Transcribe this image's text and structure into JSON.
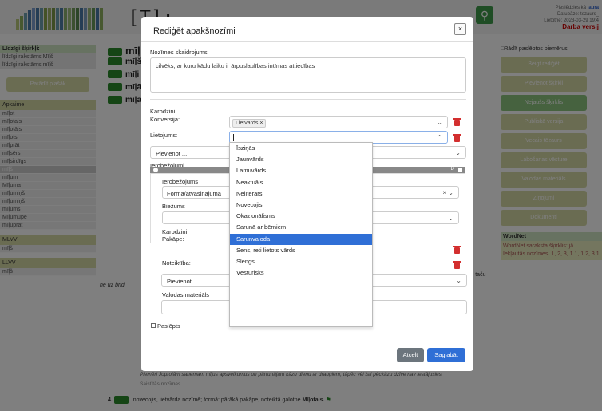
{
  "page": {
    "logo_text": "[T]:",
    "user": {
      "signed_in_prefix": "Pieslēdzies kā",
      "user": "laura",
      "database": "Datubāze: tezaurs_",
      "updated": "Lietotne: 2023-03-29 19:4",
      "version": "Darba versij"
    }
  },
  "left_sidebar": {
    "similar_title": "Līdzīgi šķirkļi:",
    "similar": [
      "līdzīgi rakstāms Mīļš",
      "līdzīgi rakstāms mīļš"
    ],
    "show_more": "Parādīt plašāk",
    "neighborhood_title": "Apkaime",
    "neighbors": [
      "mīļot",
      "mīļotais",
      "mīļotājs",
      "mīļots",
      "mīļprāt",
      "mīļsērs",
      "mīļsirdīgs",
      "mīļš",
      "mīļum",
      "Mīļuma",
      "mīļumiņš",
      "mīļumiņš",
      "mīļums",
      "Mīļumupe",
      "mīļuprāt"
    ],
    "mlvv_title": "MLVV",
    "mlvv": [
      "mīļš"
    ],
    "llvv_title": "LLVV",
    "llvv": [
      "mīļš"
    ]
  },
  "main": {
    "entry_title": "mīļš",
    "lines": [
      "mīļš",
      "mīļi",
      "mīļā",
      "mīļā"
    ],
    "sense3_tail": "usies, taču",
    "sense3_prefix": "ne uz brīd",
    "example_text": "Piemēri  Joprojām saņemam mīļus apsveikumus un pārrunājam kāzu dienu ar draugiem, tāpēc vēl īsti pēckāzu dzīve nav iestājusies.",
    "linked": "Saistītās nozīmes",
    "sense4": "novecojis, lietvārda nozīmē; formā: pārākā pakāpe, noteiktā galotne",
    "sense4_word": "Mīļotais."
  },
  "right_sidebar": {
    "show_hidden": "Rādīt paslēptos piemērus",
    "buttons": [
      "Beigt rediģēt",
      "Pievienot šķirkli",
      "Nejaušs šķirklis",
      "Publiskā versija",
      "Vecais tēzaurs",
      "Labošanas vēsture",
      "Valodas materiāls",
      "Ziņojumi",
      "Dokumenti"
    ],
    "button_colors": [
      "#d5d8a5",
      "#d5d8a5",
      "#8cc47f",
      "#d5d8a5",
      "#d5d8a5",
      "#d5d8a5",
      "#d5d8a5",
      "#d5d8a5",
      "#d5d8a5"
    ],
    "wordnet_title": "WordNet",
    "wordnet_body": "WordNet saraksta šķirklis: jā",
    "wordnet_senses": "Iekļautās nozīmes: 1, 2, 3, 1.1, 1.2, 3.1"
  },
  "modal": {
    "title": "Rediģēt apakšnozīmi",
    "close": "×",
    "gloss_label": "Nozīmes skaidrojums",
    "gloss_value": "cilvēks, ar kuru kādu laiku ir ārpuslaulības intīmas attiecības",
    "flags_label": "Karodziņi",
    "conversion_label": "Konversija:",
    "conversion_tag": "Lietvārds ×",
    "usage_label": "Lietojums:",
    "add_label": "Pievienot ...",
    "restrictions_label": "Ierobežojumi",
    "restriction_label": "Ierobežojums",
    "restriction_value": "Formā/atvasinājumā",
    "frequency_label": "Biežums",
    "flags2_label": "Karodziņi",
    "degree_label": "Pakāpe:",
    "definiteness_label": "Noteiktība:",
    "add2_label": "Pievienot ...",
    "language_material_label": "Valodas materiāls",
    "hidden_label": "Paslēpts",
    "cancel": "Atcelt",
    "save": "Saglabāt",
    "usage_options": [
      "Īsziņās",
      "Jaunvārds",
      "Lamuvārds",
      "Neaktuāls",
      "Nelīterārs",
      "Novecojis",
      "Okazionālisms",
      "Sarunā ar bērniem",
      "Sarunvaloda",
      "Sens, reti lietots vārds",
      "Slengs",
      "Vēsturisks"
    ],
    "usage_selected": "Sarunvaloda"
  }
}
